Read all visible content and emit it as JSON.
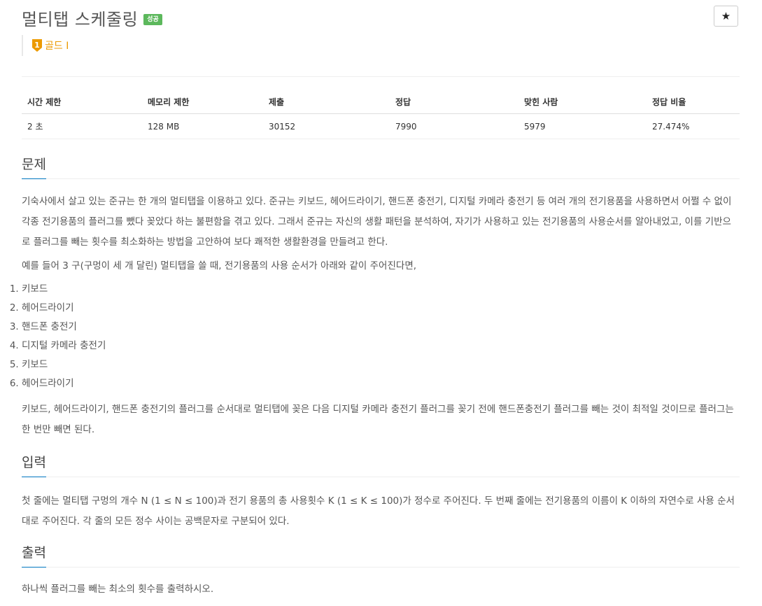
{
  "problem": {
    "title": "멀티탭 스케줄링",
    "status_badge": "성공",
    "star": "★",
    "tier_number": "1",
    "tier_label": "골드 I",
    "tier_color": "#ec9a00"
  },
  "info_table": {
    "headers": [
      "시간 제한",
      "메모리 제한",
      "제출",
      "정답",
      "맞힌 사람",
      "정답 비율"
    ],
    "values": [
      "2 초",
      "128 MB",
      "30152",
      "7990",
      "5979",
      "27.474%"
    ]
  },
  "sections": {
    "description": {
      "heading": "문제",
      "paragraph1": "기숙사에서 살고 있는 준규는 한 개의 멀티탭을 이용하고 있다. 준규는 키보드, 헤어드라이기, 핸드폰 충전기, 디지털 카메라 충전기 등 여러 개의 전기용품을 사용하면서 어쩔 수 없이 각종 전기용품의 플러그를 뺐다 꽂았다 하는 불편함을 겪고 있다. 그래서 준규는 자신의 생활 패턴을 분석하여, 자기가 사용하고 있는 전기용품의 사용순서를 알아내었고, 이를 기반으로 플러그를 빼는 횟수를 최소화하는 방법을 고안하여 보다 쾌적한 생활환경을 만들려고 한다.",
      "paragraph2": "예를 들어 3 구(구멍이 세 개 달린) 멀티탭을 쓸 때, 전기용품의 사용 순서가 아래와 같이 주어진다면,",
      "list": [
        "키보드",
        "헤어드라이기",
        "핸드폰 충전기",
        "디지털 카메라 충전기",
        "키보드",
        "헤어드라이기"
      ],
      "paragraph3": "키보드, 헤어드라이기, 핸드폰 충전기의 플러그를 순서대로 멀티탭에 꽂은 다음 디지털 카메라 충전기 플러그를 꽂기 전에 핸드폰충전기 플러그를 빼는 것이 최적일 것이므로 플러그는 한 번만 빼면 된다."
    },
    "input": {
      "heading": "입력",
      "paragraph": "첫 줄에는 멀티탭 구멍의 개수 N (1 ≤ N ≤ 100)과 전기 용품의 총 사용횟수 K (1 ≤ K ≤ 100)가 정수로 주어진다. 두 번째 줄에는 전기용품의 이름이 K 이하의 자연수로 사용 순서대로 주어진다. 각 줄의 모든 정수 사이는 공백문자로 구분되어 있다."
    },
    "output": {
      "heading": "출력",
      "paragraph": "하나씩 플러그를 빼는 최소의 횟수를 출력하시오."
    }
  }
}
